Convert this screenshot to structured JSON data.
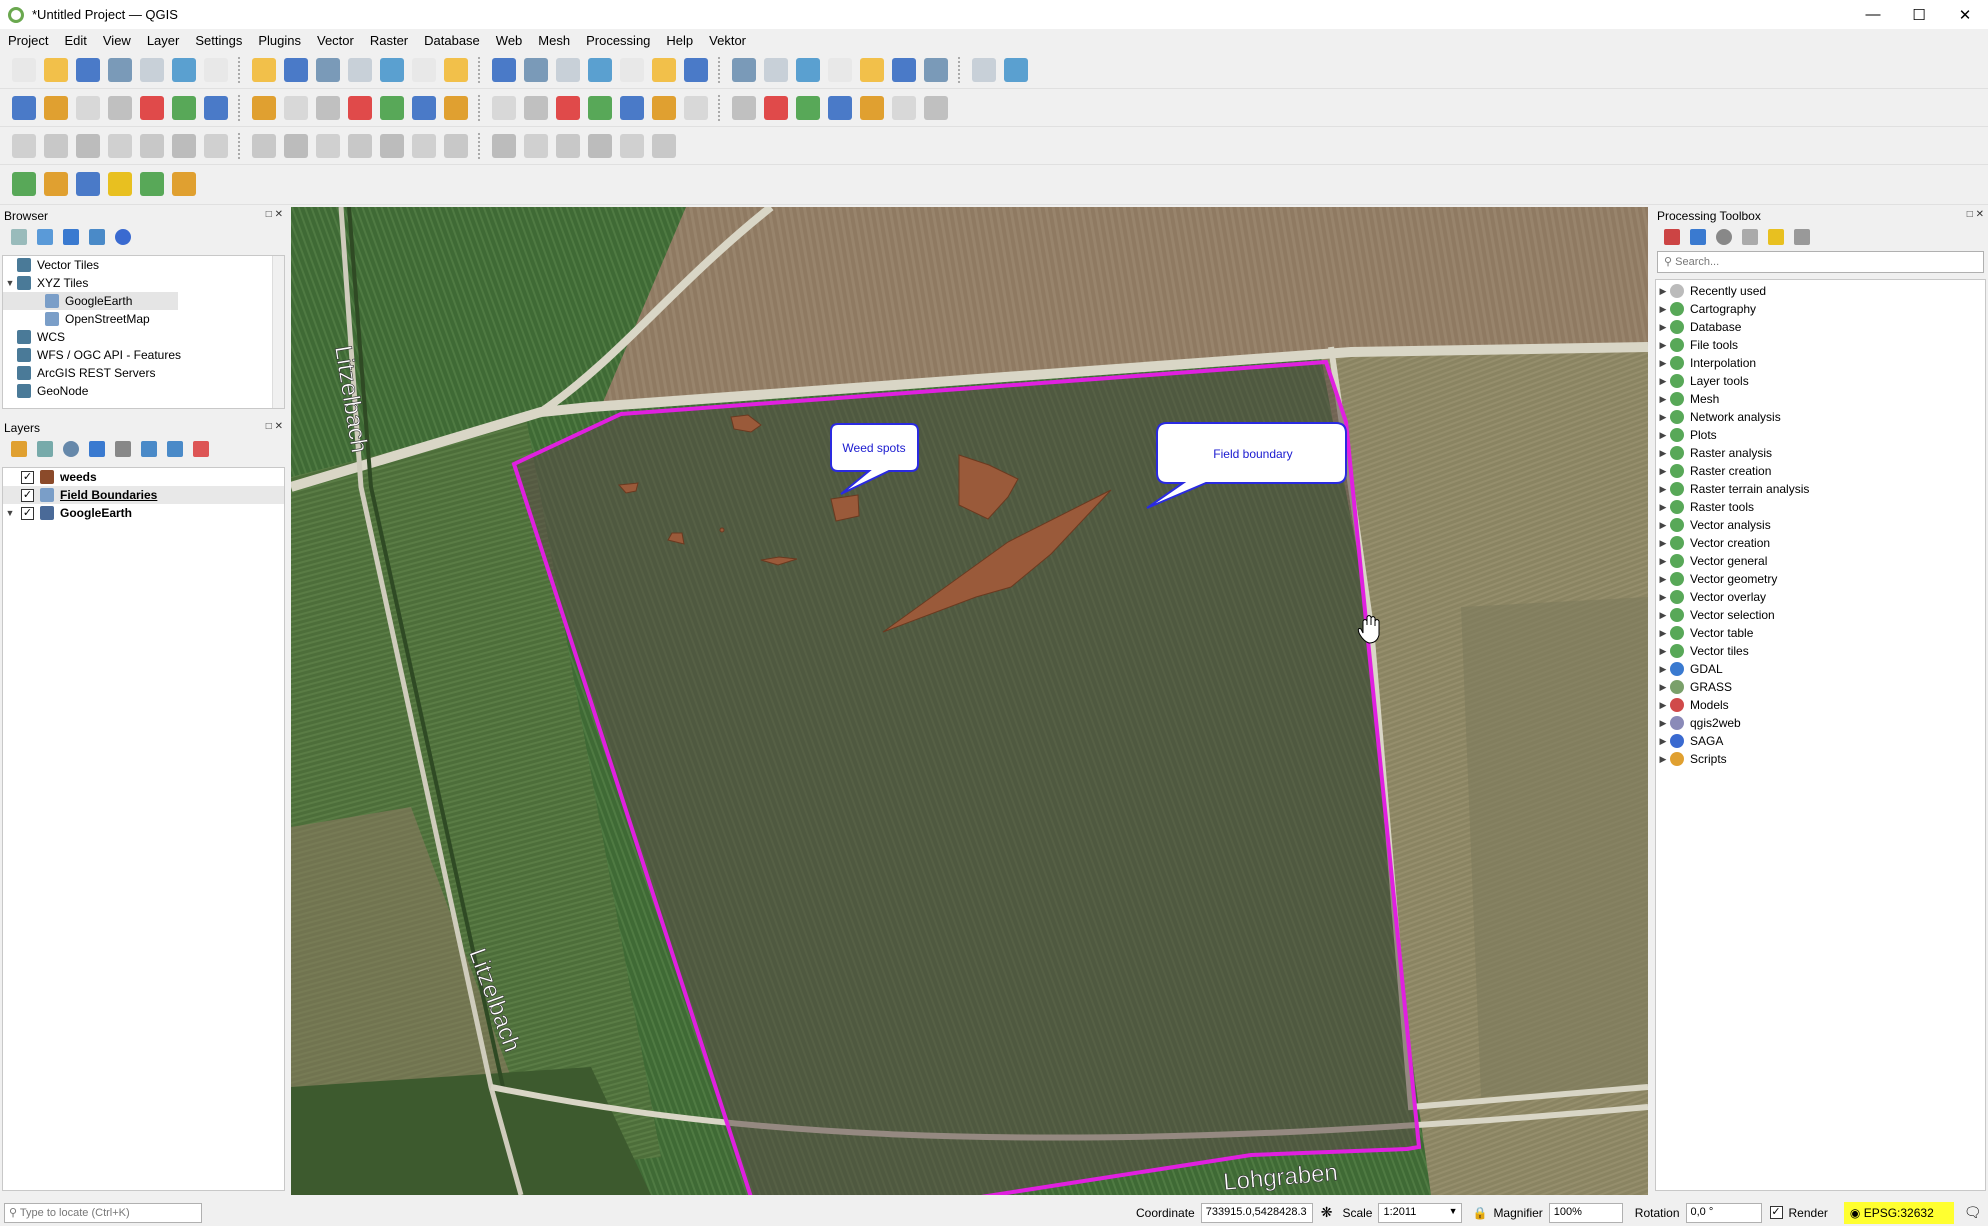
{
  "window": {
    "title": "*Untitled Project — QGIS"
  },
  "menu": [
    "Project",
    "Edit",
    "View",
    "Layer",
    "Settings",
    "Plugins",
    "Vector",
    "Raster",
    "Database",
    "Web",
    "Mesh",
    "Processing",
    "Help",
    "Vektor"
  ],
  "browser": {
    "title": "Browser",
    "items": [
      {
        "label": "Vector Tiles",
        "icon": "vector-tiles-icon",
        "level": 0,
        "expand": ""
      },
      {
        "label": "XYZ Tiles",
        "icon": "xyz-tiles-icon",
        "level": 0,
        "expand": "▼"
      },
      {
        "label": "GoogleEarth",
        "icon": "tile-layer-icon",
        "level": 1,
        "expand": "",
        "selected": true
      },
      {
        "label": "OpenStreetMap",
        "icon": "tile-layer-icon",
        "level": 1,
        "expand": ""
      },
      {
        "label": "WCS",
        "icon": "wcs-icon",
        "level": 0,
        "expand": ""
      },
      {
        "label": "WFS / OGC API - Features",
        "icon": "wfs-icon",
        "level": 0,
        "expand": ""
      },
      {
        "label": "ArcGIS REST Servers",
        "icon": "arcgis-icon",
        "level": 0,
        "expand": ""
      },
      {
        "label": "GeoNode",
        "icon": "geonode-icon",
        "level": 0,
        "expand": ""
      }
    ]
  },
  "layers": {
    "title": "Layers",
    "items": [
      {
        "label": "weeds",
        "bold": true,
        "underline": false
      },
      {
        "label": "Field Boundaries",
        "bold": true,
        "underline": true
      },
      {
        "label": "GoogleEarth",
        "bold": true,
        "underline": false
      }
    ]
  },
  "toolbox": {
    "title": "Processing Toolbox",
    "search_placeholder": "Search...",
    "items": [
      "Recently used",
      "Cartography",
      "Database",
      "File tools",
      "Interpolation",
      "Layer tools",
      "Mesh",
      "Network analysis",
      "Plots",
      "Raster analysis",
      "Raster creation",
      "Raster terrain analysis",
      "Raster tools",
      "Vector analysis",
      "Vector creation",
      "Vector general",
      "Vector geometry",
      "Vector overlay",
      "Vector selection",
      "Vector table",
      "Vector tiles",
      "GDAL",
      "GRASS",
      "Models",
      "qgis2web",
      "SAGA",
      "Scripts"
    ]
  },
  "map": {
    "callouts": {
      "weed": "Weed spots",
      "field": "Field boundary"
    },
    "road_labels": {
      "litz1": "Litzelbach",
      "litz2": "Litzelbach",
      "lohgraben": "Lohgraben"
    },
    "colors": {
      "boundary": "#e020e0",
      "weed_fill": "#9a5a3a"
    }
  },
  "status": {
    "locate_placeholder": "Type to locate (Ctrl+K)",
    "coordinate_label": "Coordinate",
    "coordinate": "733915.0,5428428.3",
    "scale_label": "Scale",
    "scale": "1:2011",
    "magnifier_label": "Magnifier",
    "magnifier": "100%",
    "rotation_label": "Rotation",
    "rotation": "0,0 °",
    "render_label": "Render",
    "crs": "EPSG:32632"
  }
}
